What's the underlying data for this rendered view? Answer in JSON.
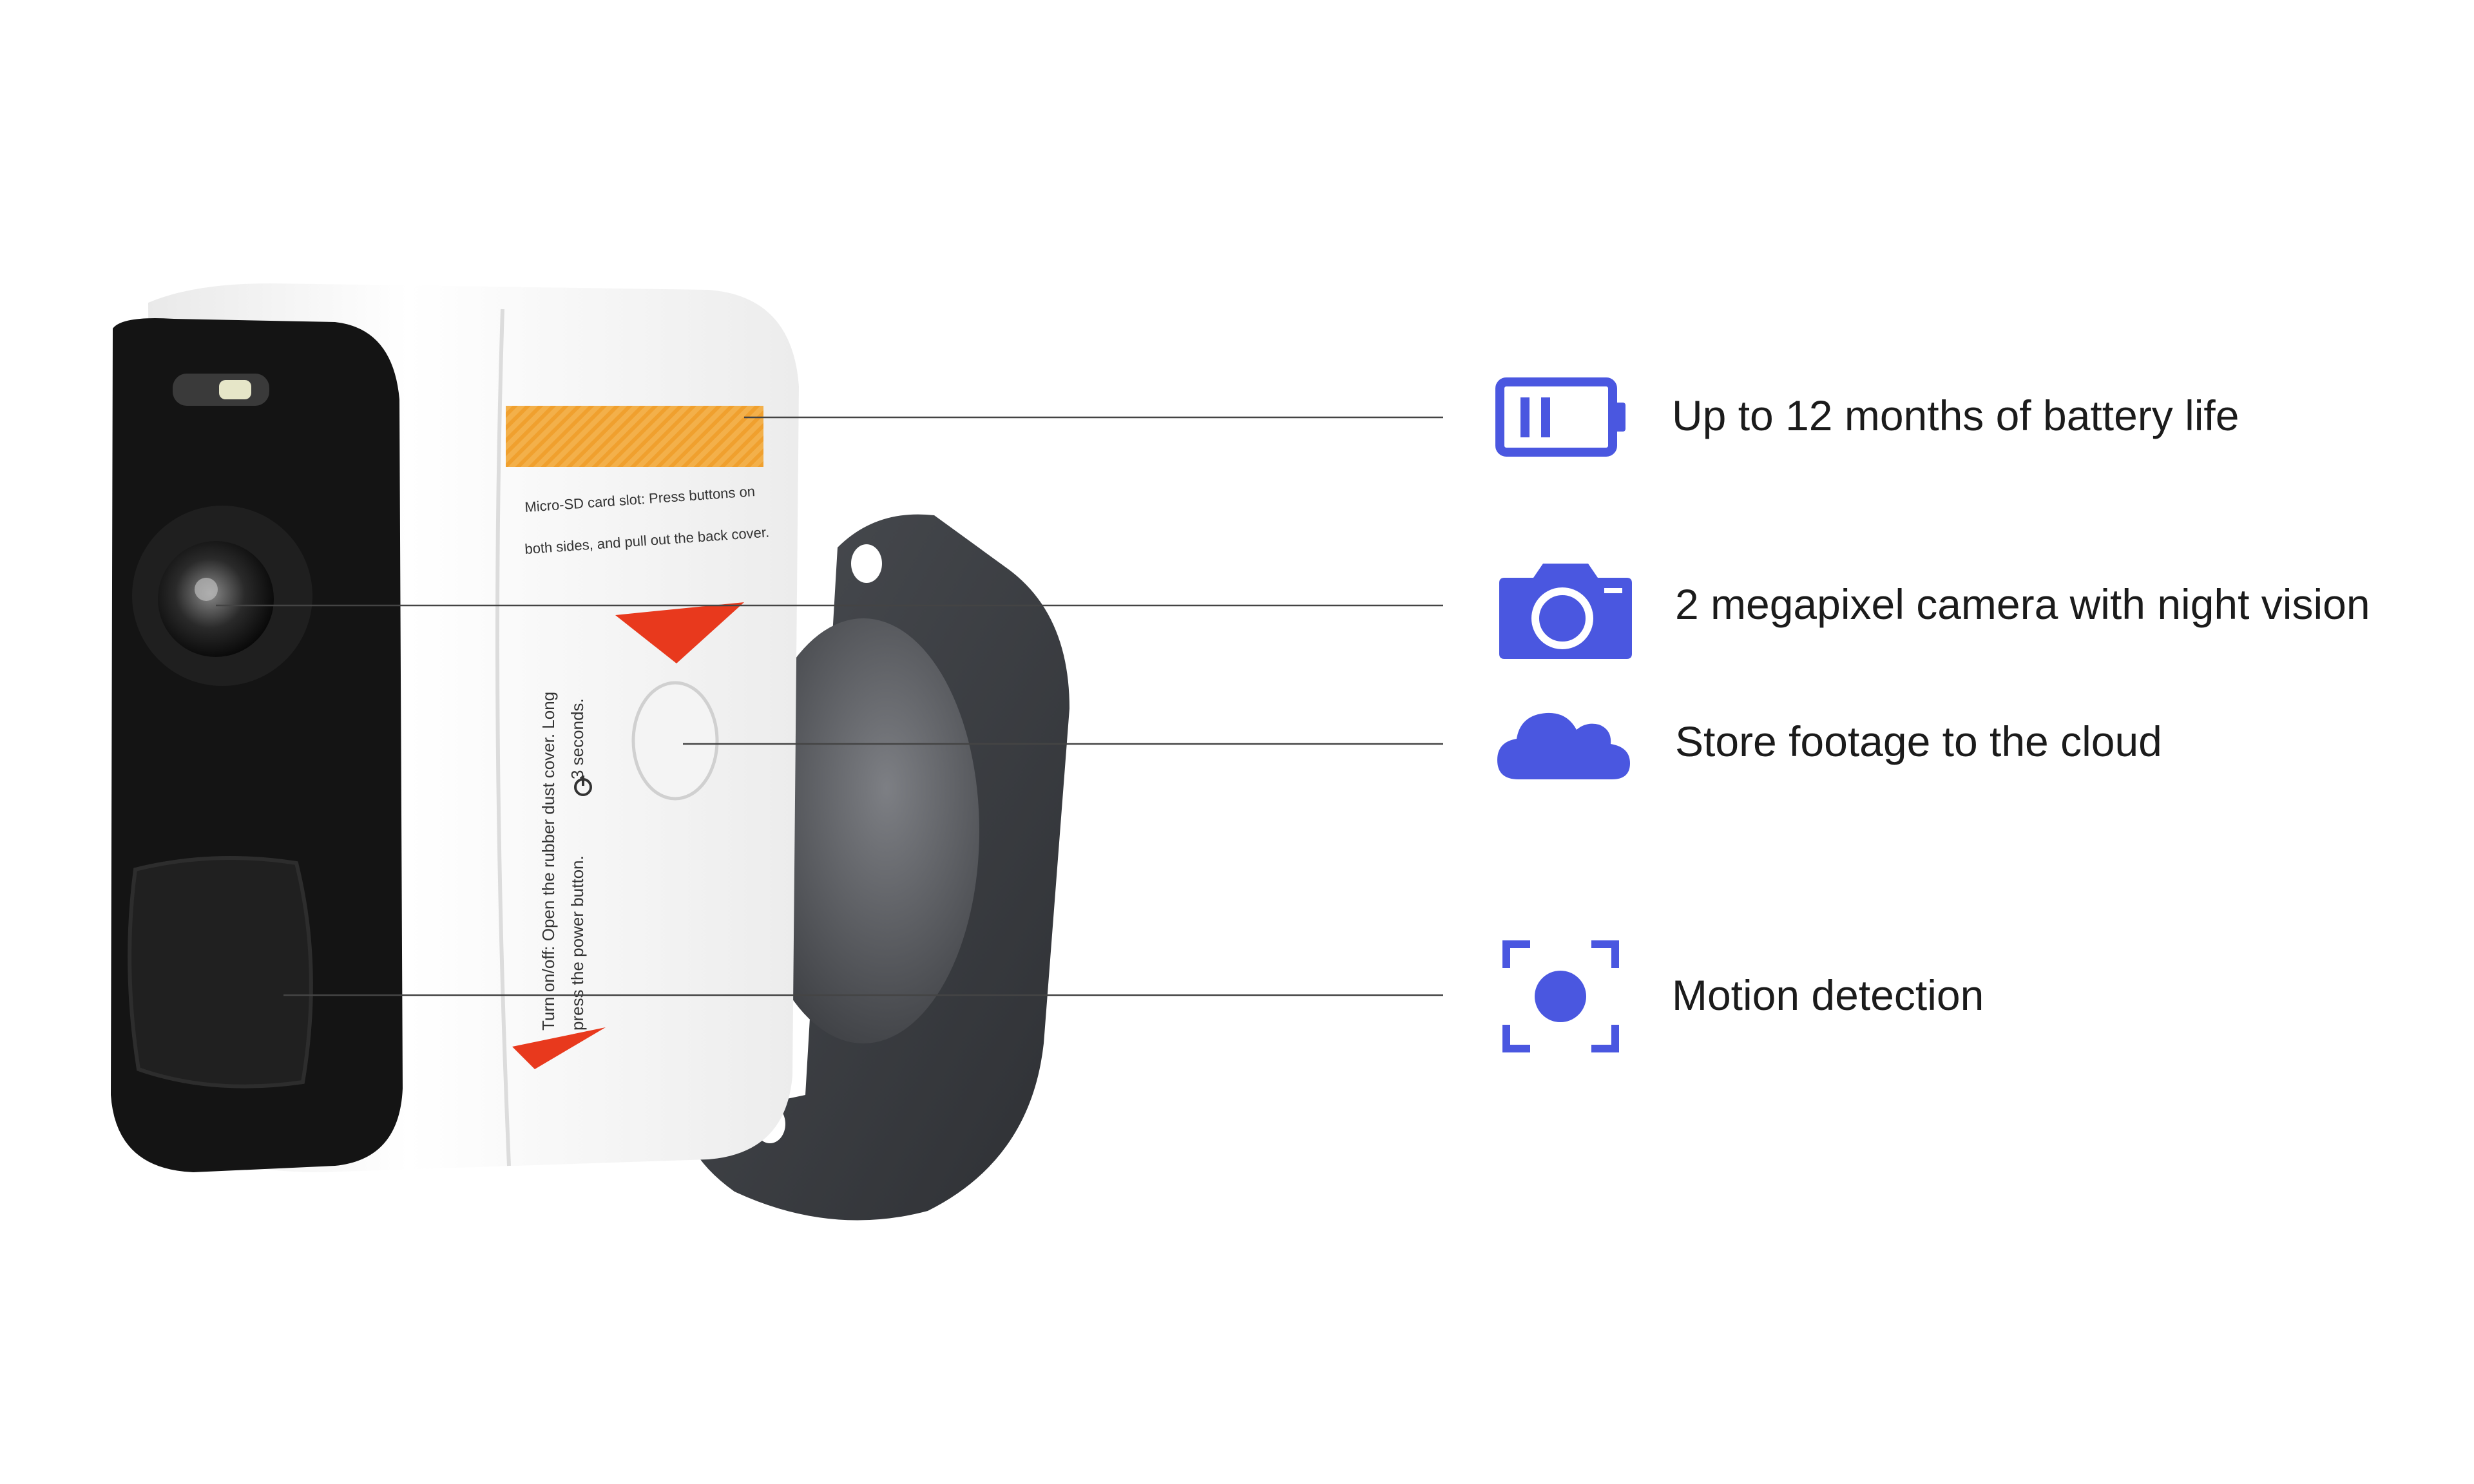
{
  "camera": {
    "sd_text_line1": "Micro-SD card slot: Press buttons on",
    "sd_text_line2": "both sides, and pull out the back cover.",
    "power_text_line1": "Turn on/off: Open the rubber dust cover. Long",
    "power_text_line2": "press the power button.",
    "power_text_line3": "3 seconds."
  },
  "features": [
    {
      "label": "Up to 12 months of battery life",
      "icon": "battery-icon"
    },
    {
      "label": "2 megapixel camera with night vision",
      "icon": "camera-icon"
    },
    {
      "label": "Store footage to the cloud",
      "icon": "cloud-icon"
    },
    {
      "label": "Motion detection",
      "icon": "motion-detection-icon"
    }
  ],
  "colors": {
    "icon": "#4a57e0",
    "leader_line": "#444444",
    "camera_body": "#f5f5f5",
    "camera_face": "#141414",
    "mount": "#3d4045",
    "sticker": "#f2a93b",
    "arrow": "#e8391d"
  }
}
